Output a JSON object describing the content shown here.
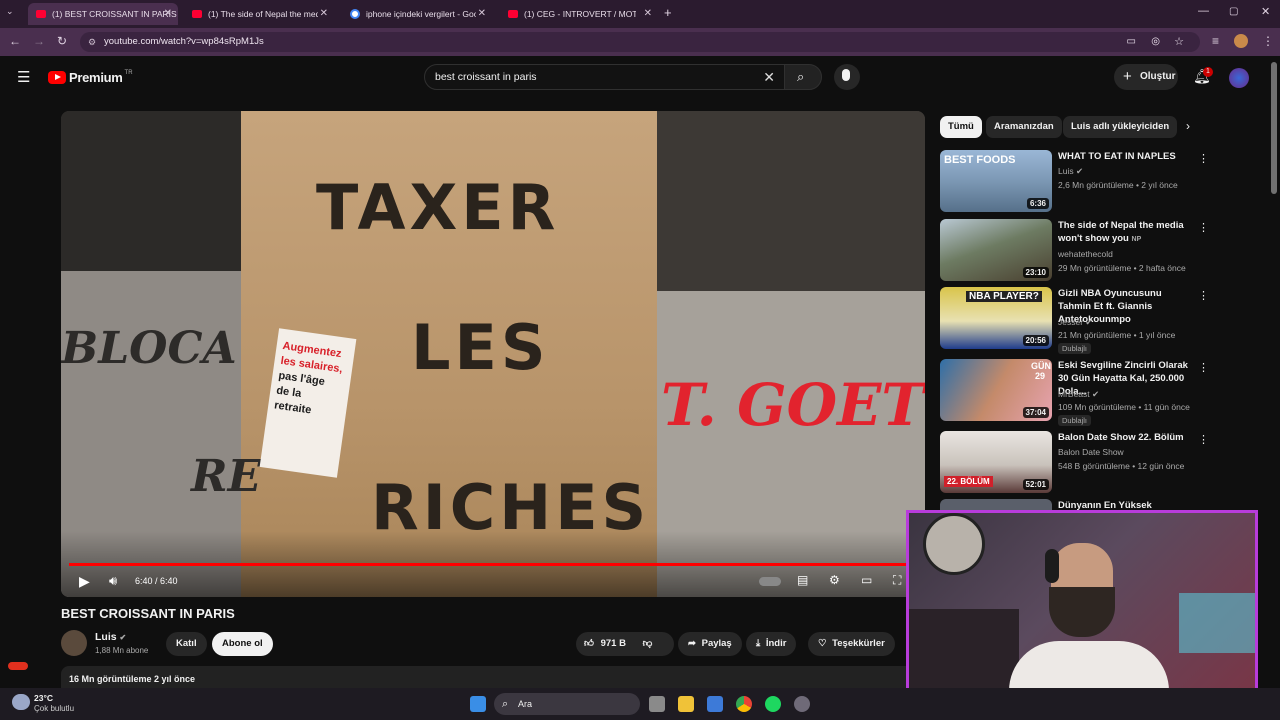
{
  "browser": {
    "tabs": [
      {
        "label": "(1) BEST CROISSANT IN PARIS",
        "active": true
      },
      {
        "label": "(1) The side of Nepal the media",
        "active": false
      },
      {
        "label": "iphone içindeki vergilert - Google",
        "active": false
      },
      {
        "label": "(1) CEG - INTROVERT / MOTIVE",
        "active": false
      }
    ],
    "url": "youtube.com/watch?v=wp84sRpM1Js"
  },
  "header": {
    "logo": "Premium",
    "logo_badge": "TR",
    "search_value": "best croissant in paris",
    "create_label": "Oluştur",
    "notif_count": "1"
  },
  "player": {
    "time": "6:40 / 6:40",
    "sign_lines": [
      "TAXER",
      "LES",
      "RICHES"
    ],
    "paper_lines": [
      "Augmentez",
      "les salaires,",
      "pas l'âge",
      "de la",
      "retraite"
    ],
    "graffiti": "T. GOET",
    "graffiti_left": "BLOCA",
    "graffiti_left2": "RE"
  },
  "video": {
    "title": "BEST CROISSANT IN PARIS",
    "channel": "Luis",
    "subscribers": "1,88 Mn abone",
    "join_label": "Katıl",
    "subscribe_label": "Abone ol",
    "likes": "971 B",
    "share_label": "Paylaş",
    "download_label": "İndir",
    "thanks_label": "Teşekkürler",
    "stats": "16 Mn görüntüleme  2 yıl önce"
  },
  "sidebar": {
    "chips": [
      "Tümü",
      "Aramanızdan",
      "Luis adlı yükleyiciden"
    ],
    "cards": [
      {
        "title": "WHAT TO EAT IN NAPLES",
        "channel": "Luis",
        "meta": "2,6 Mn görüntüleme • 2 yıl önce",
        "duration": "6:36",
        "thumb_text": "BEST FOODS",
        "dub": ""
      },
      {
        "title": "The side of Nepal the media won't show you",
        "title_suffix": "NP",
        "channel": "wehatethecold",
        "meta": "29 Mn görüntüleme • 2 hafta önce",
        "duration": "23:10",
        "thumb_text": "",
        "dub": ""
      },
      {
        "title": "Gizli NBA Oyuncusunu Tahmin Et ft. Giannis Antetokounmpo",
        "channel": "Jesser",
        "meta": "21 Mn görüntüleme • 1 yıl önce",
        "duration": "20:56",
        "thumb_text": "NBA PLAYER?",
        "dub": "Dublajlı"
      },
      {
        "title": "Eski Sevgiline Zincirli Olarak 30 Gün Hayatta Kal, 250.000 Dola...",
        "channel": "MrBeast",
        "meta": "109 Mn görüntüleme • 11 gün önce",
        "duration": "37:04",
        "thumb_text": "GÜN 29",
        "dub": "Dublajlı"
      },
      {
        "title": "Balon Date Show 22. Bölüm",
        "channel": "Balon Date Show",
        "meta": "548 B görüntüleme • 12 gün önce",
        "duration": "52:01",
        "thumb_text": "22. BÖLÜM",
        "dub": ""
      },
      {
        "title": "Dünyanın En Yüksek Güvenlikli",
        "channel": "",
        "meta": "",
        "duration": "",
        "thumb_text": "",
        "dub": ""
      }
    ]
  },
  "taskbar": {
    "temp": "23°C",
    "weather": "Çok bulutlu",
    "search_label": "Ara"
  }
}
